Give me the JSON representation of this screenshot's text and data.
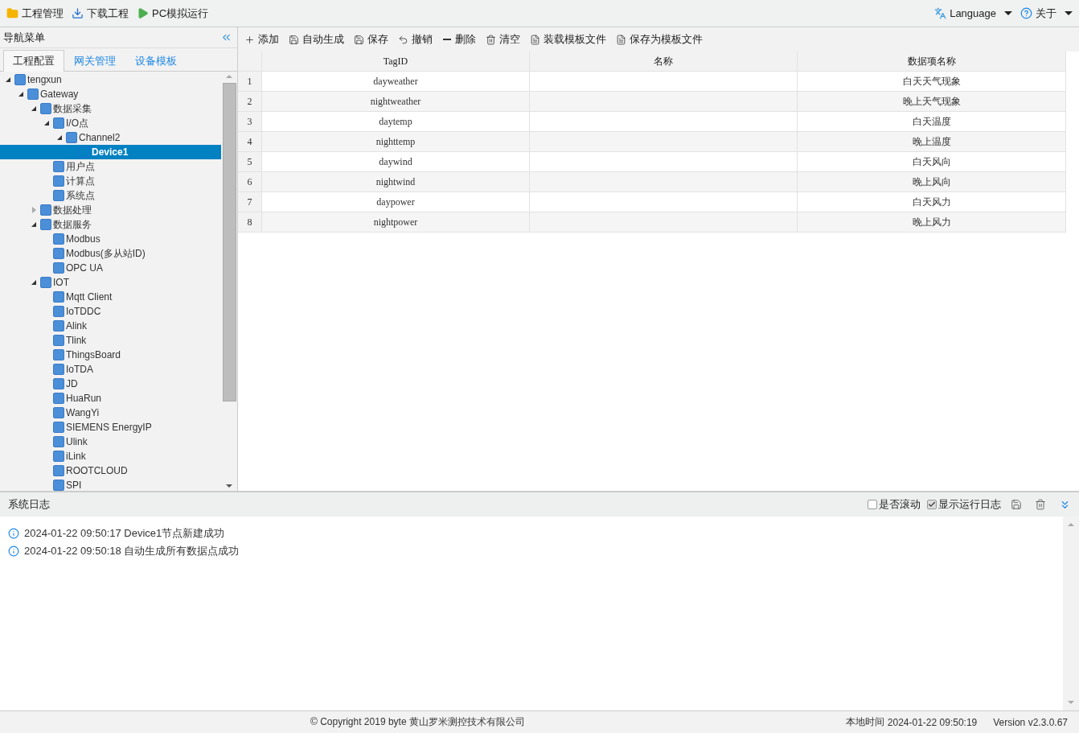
{
  "top_menu": {
    "left": [
      "工程管理",
      "下载工程",
      "PC模拟运行"
    ],
    "right": [
      "Language",
      "关于"
    ]
  },
  "nav": {
    "title": "导航菜单",
    "tabs": [
      {
        "label": "工程配置",
        "selected": true
      },
      {
        "label": "网关管理",
        "selected": false
      },
      {
        "label": "设备模板",
        "selected": false
      }
    ],
    "tree": [
      {
        "label": "tengxun",
        "expanded": true,
        "selected": false,
        "children": [
          {
            "label": "Gateway",
            "expanded": true,
            "selected": false,
            "children": [
              {
                "label": "数据采集",
                "expanded": true,
                "selected": false,
                "children": [
                  {
                    "label": "I/O点",
                    "expanded": true,
                    "selected": false,
                    "children": [
                      {
                        "label": "Channel2",
                        "expanded": true,
                        "selected": false,
                        "children": [
                          {
                            "label": "Device1",
                            "selected": true
                          }
                        ]
                      }
                    ]
                  },
                  {
                    "label": "用户点",
                    "selected": false
                  },
                  {
                    "label": "计算点",
                    "selected": false
                  },
                  {
                    "label": "系统点",
                    "selected": false
                  }
                ]
              },
              {
                "label": "数据处理",
                "expanded": false,
                "selected": false
              },
              {
                "label": "数据服务",
                "expanded": true,
                "selected": false,
                "children": [
                  {
                    "label": "Modbus",
                    "selected": false
                  },
                  {
                    "label": "Modbus(多从站ID)",
                    "selected": false
                  },
                  {
                    "label": "OPC UA",
                    "selected": false
                  }
                ]
              },
              {
                "label": "IOT",
                "expanded": true,
                "selected": false,
                "children": [
                  {
                    "label": "Mqtt Client",
                    "selected": false
                  },
                  {
                    "label": "IoTDDC",
                    "selected": false
                  },
                  {
                    "label": "Alink",
                    "selected": false
                  },
                  {
                    "label": "Tlink",
                    "selected": false
                  },
                  {
                    "label": "ThingsBoard",
                    "selected": false
                  },
                  {
                    "label": "IoTDA",
                    "selected": false
                  },
                  {
                    "label": "JD",
                    "selected": false
                  },
                  {
                    "label": "HuaRun",
                    "selected": false
                  },
                  {
                    "label": "WangYi",
                    "selected": false
                  },
                  {
                    "label": "SIEMENS EnergyIP",
                    "selected": false
                  },
                  {
                    "label": "Ulink",
                    "selected": false
                  },
                  {
                    "label": "iLink",
                    "selected": false
                  },
                  {
                    "label": "ROOTCLOUD",
                    "selected": false
                  },
                  {
                    "label": "SPI",
                    "selected": false
                  }
                ]
              }
            ]
          }
        ]
      }
    ]
  },
  "toolbar": [
    "添加",
    "自动生成",
    "保存",
    "撤销",
    "删除",
    "清空",
    "装载模板文件",
    "保存为模板文件"
  ],
  "table": {
    "columns": [
      "TagID",
      "名称",
      "数据项名称"
    ],
    "rows": [
      {
        "index": "1",
        "tagid": "dayweather",
        "item": "白天天气现象"
      },
      {
        "index": "2",
        "tagid": "nightweather",
        "item": "晚上天气现象"
      },
      {
        "index": "3",
        "tagid": "daytemp",
        "item": "白天温度"
      },
      {
        "index": "4",
        "tagid": "nighttemp",
        "item": "晚上温度"
      },
      {
        "index": "5",
        "tagid": "daywind",
        "item": "白天风向"
      },
      {
        "index": "6",
        "tagid": "nightwind",
        "item": "晚上风向"
      },
      {
        "index": "7",
        "tagid": "daypower",
        "item": "白天风力"
      },
      {
        "index": "8",
        "tagid": "nightpower",
        "item": "晚上风力"
      }
    ]
  },
  "log": {
    "title": "系统日志",
    "options": [
      {
        "label": "是否滚动",
        "checked": false
      },
      {
        "label": "显示运行日志",
        "checked": true
      }
    ],
    "entries": [
      "2024-01-22 09:50:17 Device1节点新建成功",
      "2024-01-22 09:50:18 自动生成所有数据点成功"
    ]
  },
  "status_bar": {
    "copyright": "© Copyright 2019 byte 黄山罗米测控技术有限公司",
    "local_time_label": "本地时间",
    "local_time": "2024-01-22 09:50:19",
    "version": "Version v2.3.0.67"
  }
}
